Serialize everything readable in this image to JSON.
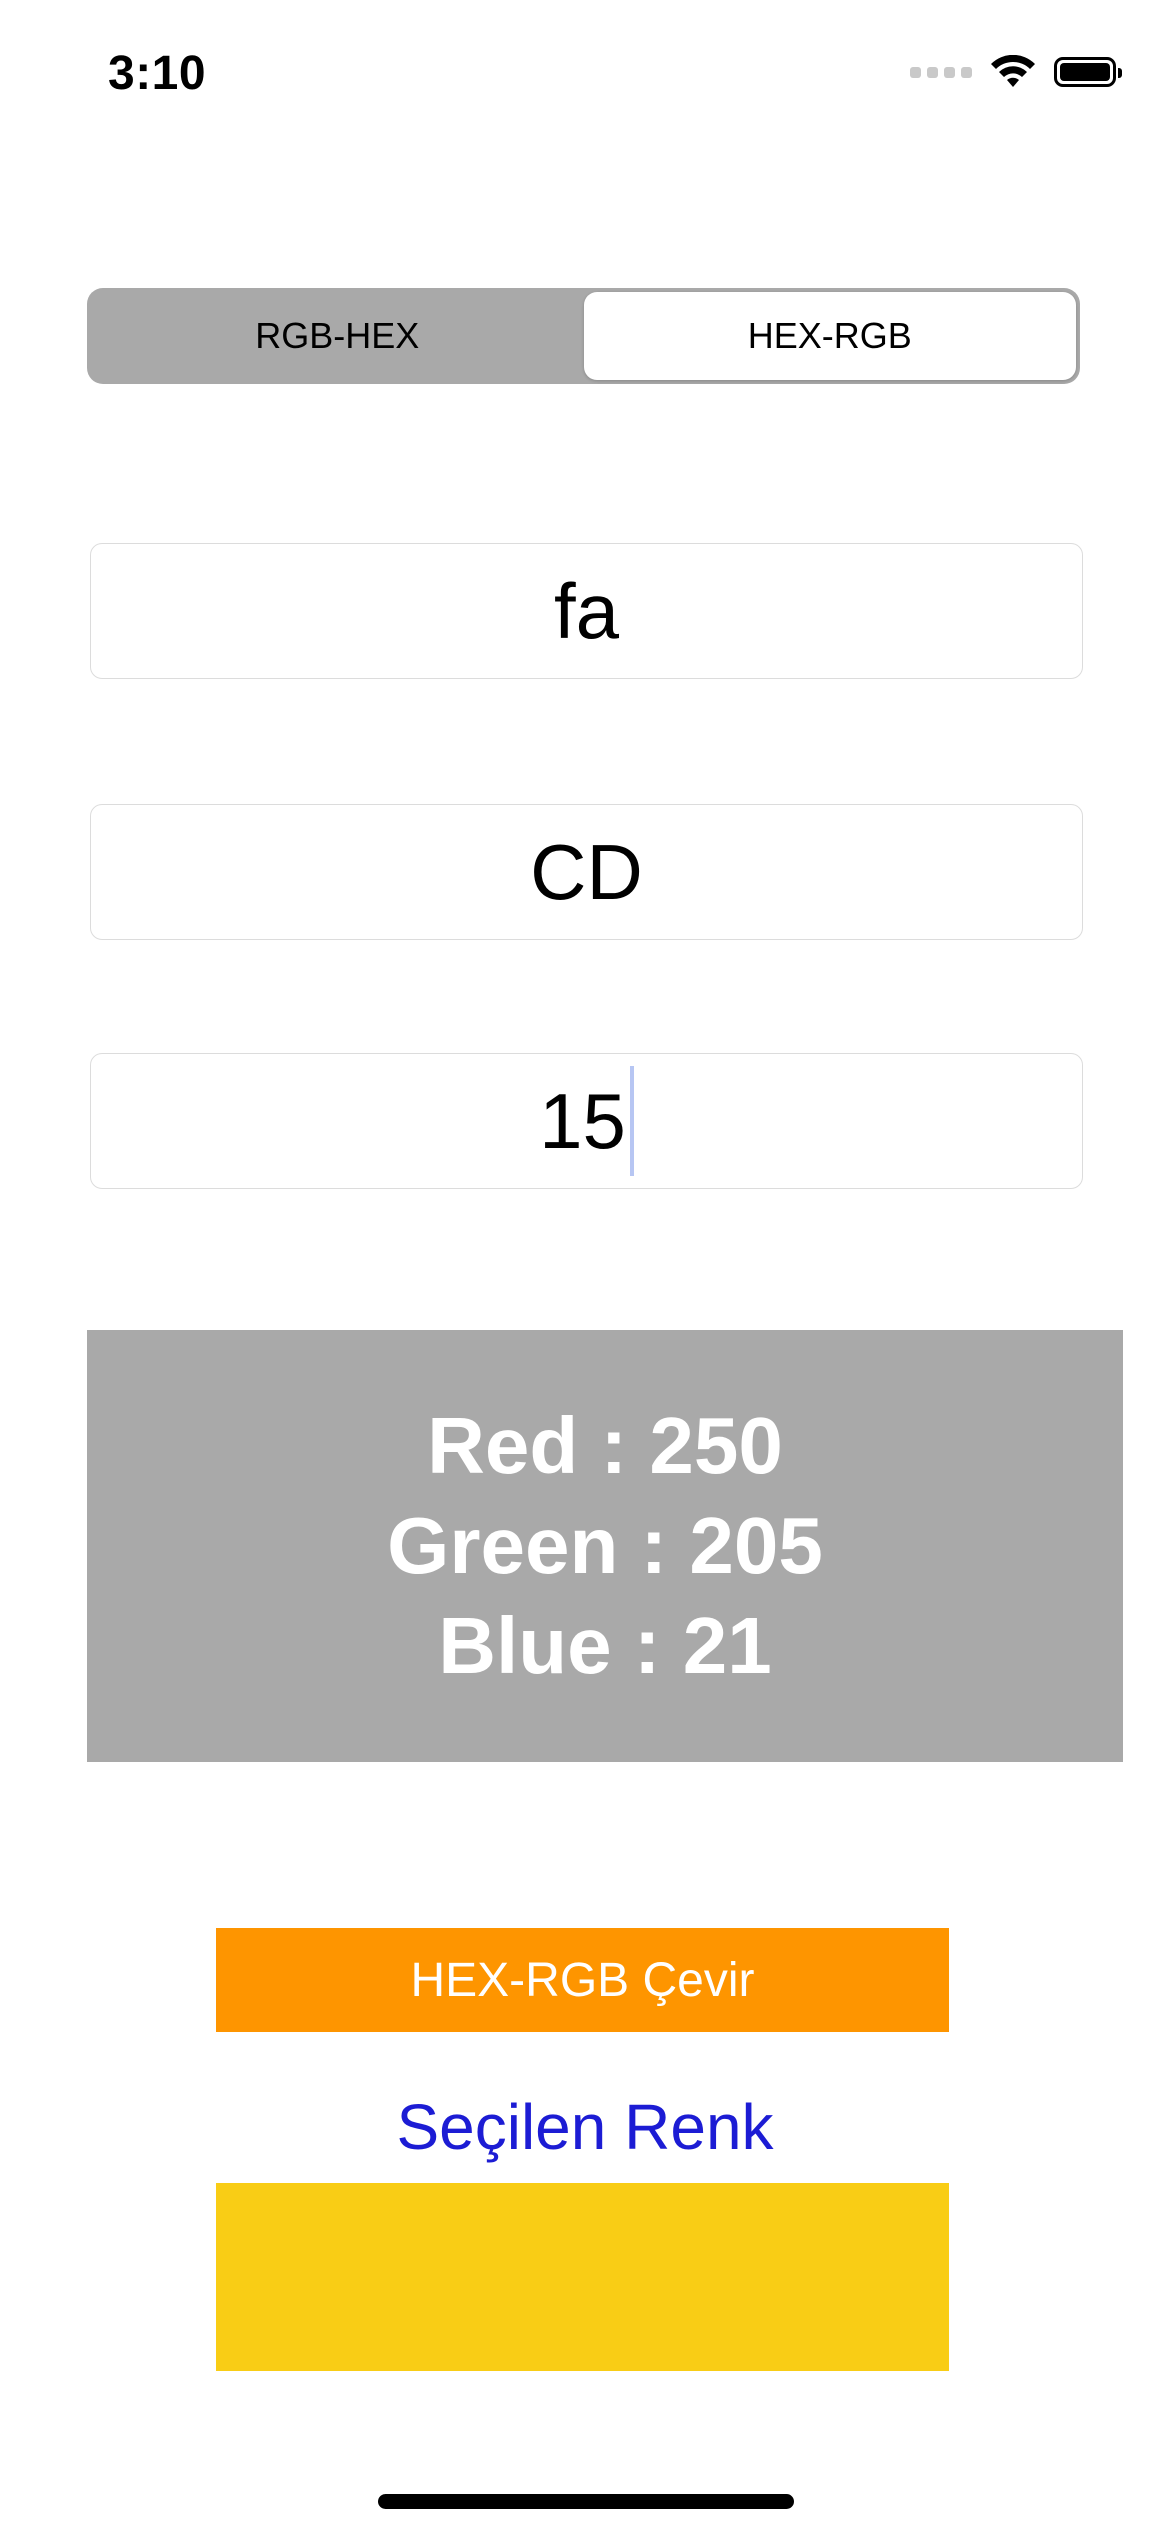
{
  "status_bar": {
    "time": "3:10"
  },
  "segmented_control": {
    "segments": [
      {
        "label": "RGB-HEX",
        "selected": false
      },
      {
        "label": "HEX-RGB",
        "selected": true
      }
    ]
  },
  "inputs": {
    "red": "fa",
    "green": "CD",
    "blue": "15"
  },
  "result": {
    "red_line": "Red : 250",
    "green_line": "Green : 205",
    "blue_line": "Blue : 21"
  },
  "convert_button": {
    "label": "HEX-RGB Çevir"
  },
  "selected_color": {
    "label": "Seçilen Renk",
    "swatch_color": "#f9cd15"
  },
  "colors": {
    "accent_orange": "#fe9500",
    "panel_gray": "#a9a9a9",
    "label_blue": "#1c1cd4"
  },
  "icons": {
    "signal": "cellular-signal-icon",
    "wifi": "wifi-icon",
    "battery": "battery-icon"
  }
}
